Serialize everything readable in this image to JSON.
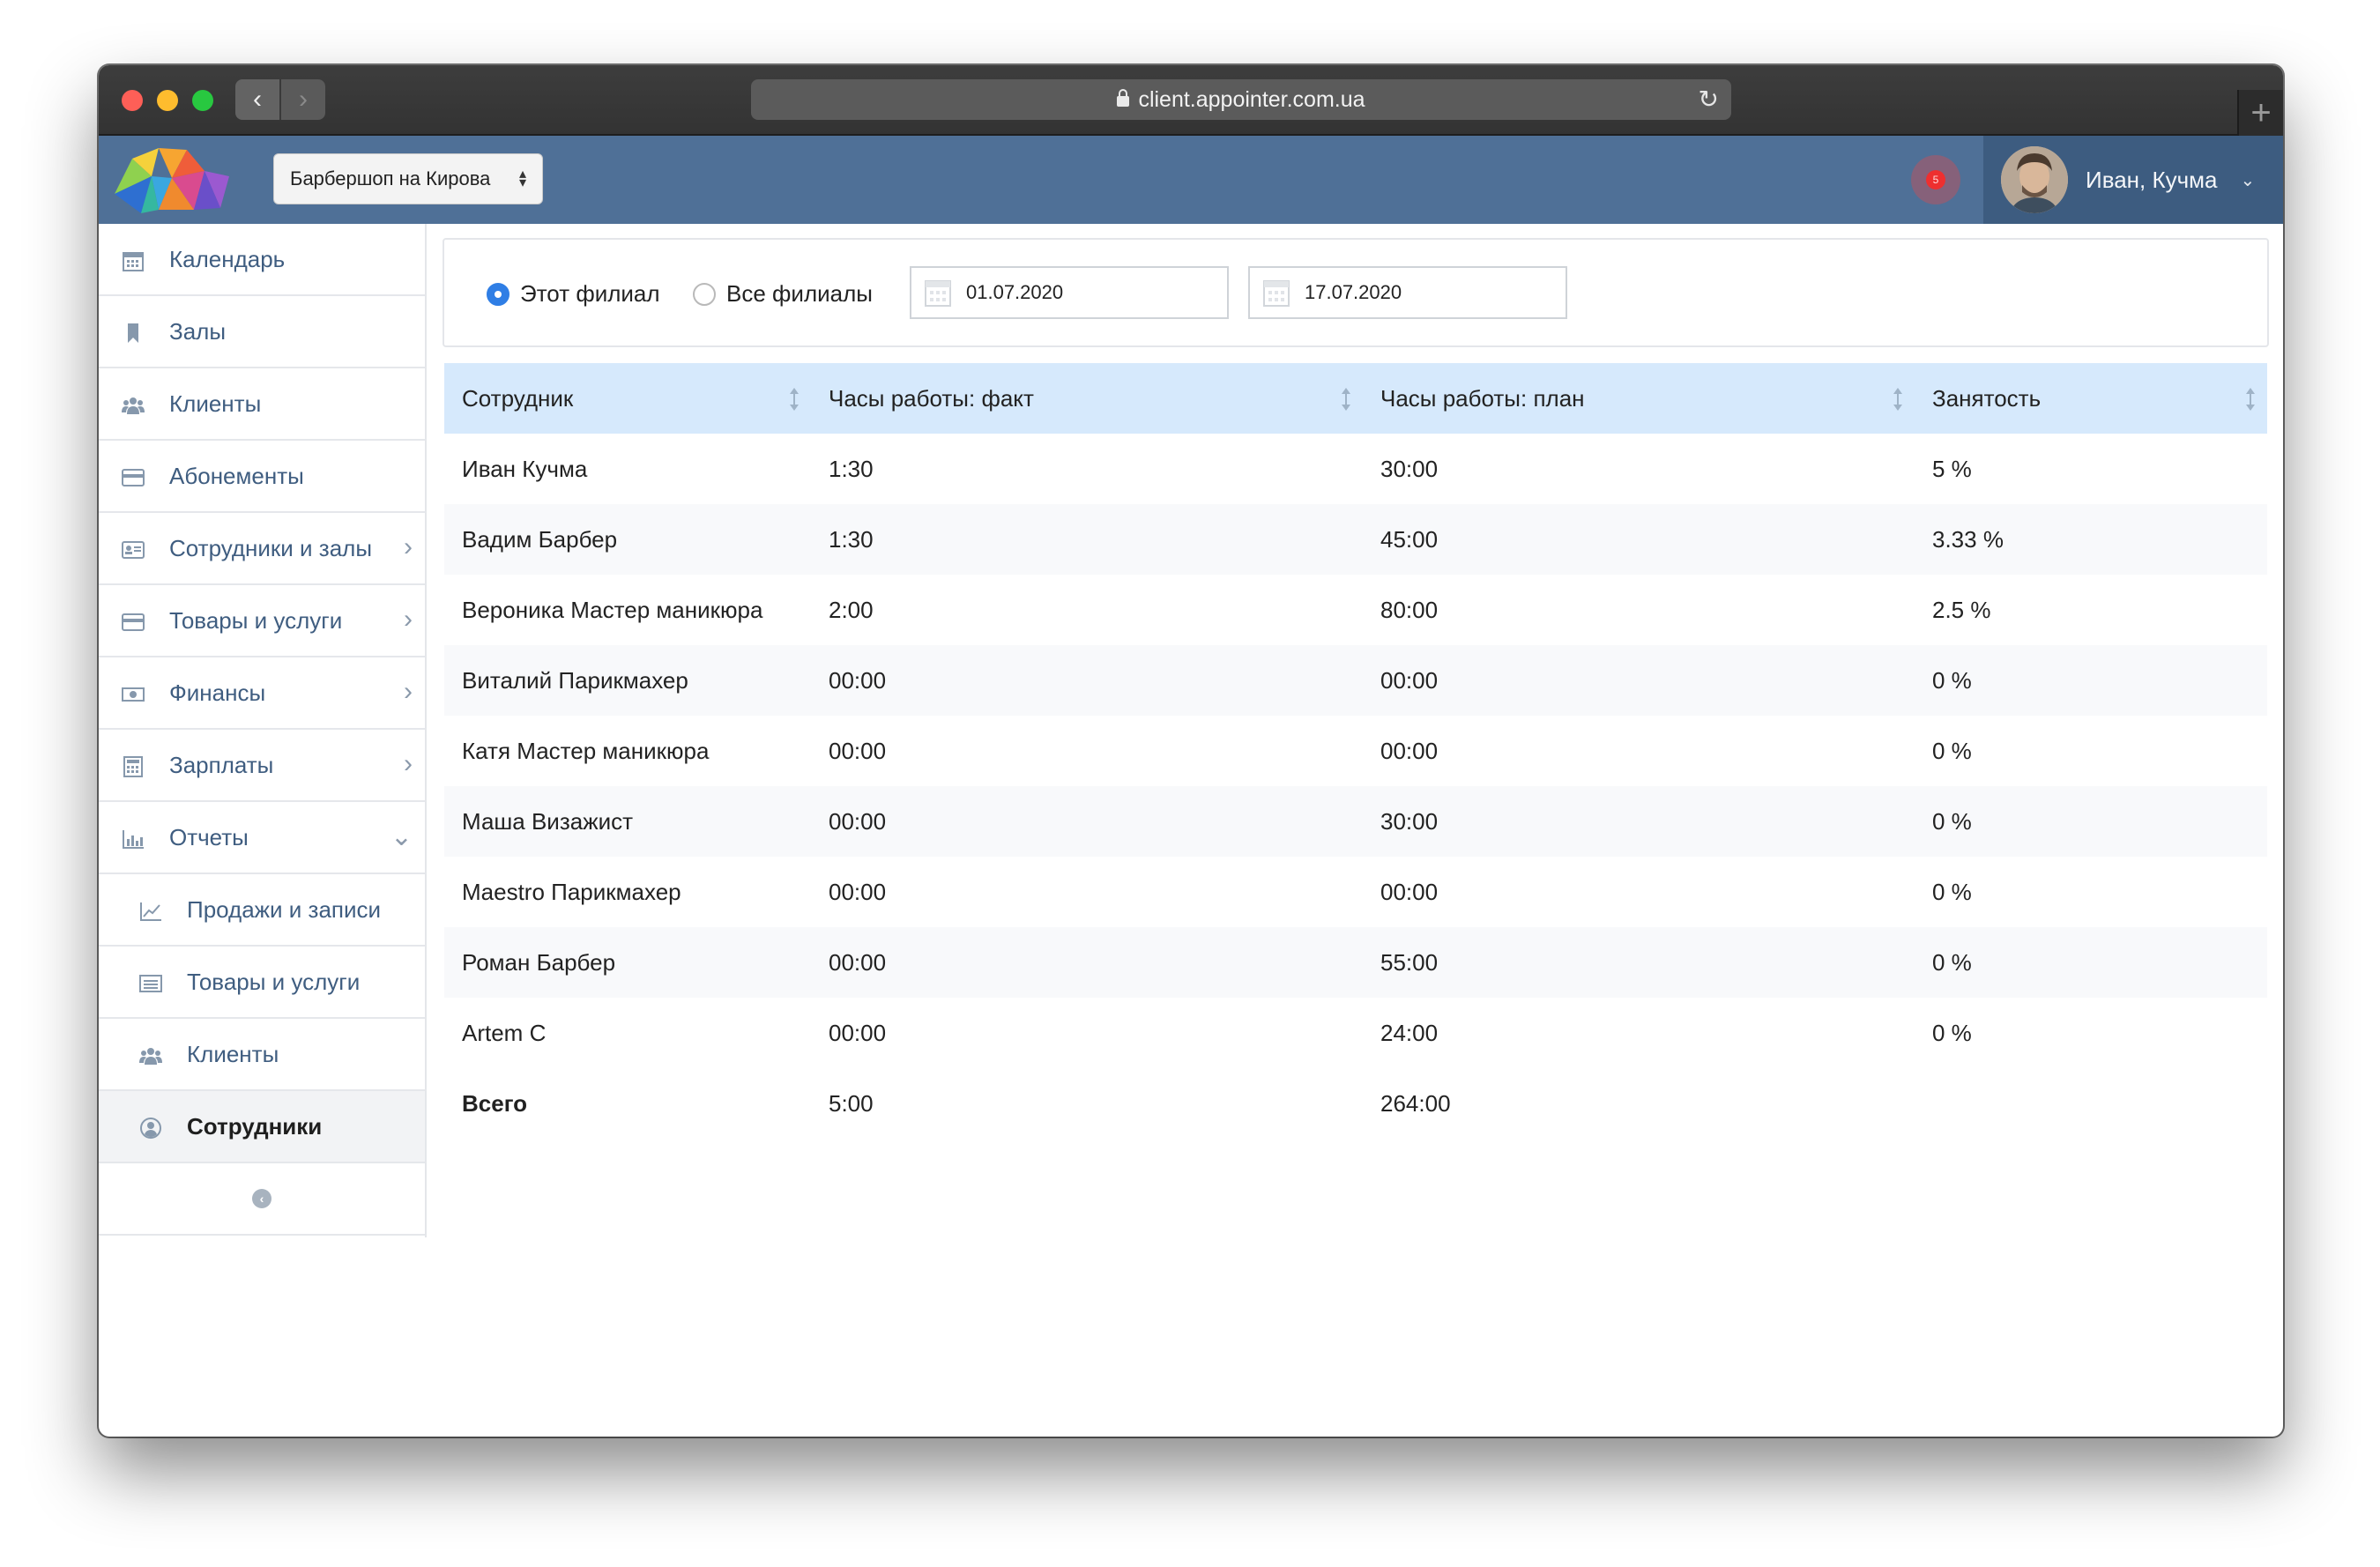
{
  "browser": {
    "url": "client.appointer.com.ua"
  },
  "header": {
    "branch": "Барбершоп на Кирова",
    "notifications_count": "5",
    "user_name": "Иван, Кучма"
  },
  "sidebar": {
    "items": [
      {
        "label": "Календарь",
        "icon": "calendar-icon"
      },
      {
        "label": "Залы",
        "icon": "bookmark-icon"
      },
      {
        "label": "Клиенты",
        "icon": "users-icon"
      },
      {
        "label": "Абонементы",
        "icon": "card-icon"
      },
      {
        "label": "Сотрудники и залы",
        "icon": "id-card-icon"
      },
      {
        "label": "Товары и услуги",
        "icon": "card-icon"
      },
      {
        "label": "Финансы",
        "icon": "money-icon"
      },
      {
        "label": "Зарплаты",
        "icon": "calculator-icon"
      },
      {
        "label": "Отчеты",
        "icon": "bar-chart-icon"
      }
    ],
    "report_items": [
      {
        "label": "Продажи и записи",
        "icon": "line-chart-icon"
      },
      {
        "label": "Товары и услуги",
        "icon": "list-icon"
      },
      {
        "label": "Клиенты",
        "icon": "users-icon"
      },
      {
        "label": "Сотрудники",
        "icon": "user-circle-icon"
      }
    ]
  },
  "filters": {
    "this_branch": "Этот филиал",
    "all_branches": "Все филиалы",
    "selected": "this_branch",
    "date_from": "01.07.2020",
    "date_to": "17.07.2020"
  },
  "table": {
    "columns": [
      "Сотрудник",
      "Часы работы: факт",
      "Часы работы: план",
      "Занятость"
    ],
    "rows": [
      [
        "Иван Кучма",
        "1:30",
        "30:00",
        "5 %"
      ],
      [
        "Вадим Барбер",
        "1:30",
        "45:00",
        "3.33 %"
      ],
      [
        "Вероника Мастер маникюра",
        "2:00",
        "80:00",
        "2.5 %"
      ],
      [
        "Виталий Парикмахер",
        "00:00",
        "00:00",
        "0 %"
      ],
      [
        "Катя Мастер маникюра",
        "00:00",
        "00:00",
        "0 %"
      ],
      [
        "Маша Визажист",
        "00:00",
        "30:00",
        "0 %"
      ],
      [
        "Maestro Парикмахер",
        "00:00",
        "00:00",
        "0 %"
      ],
      [
        "Роман Барбер",
        "00:00",
        "55:00",
        "0 %"
      ],
      [
        "Artem C",
        "00:00",
        "24:00",
        "0 %"
      ]
    ],
    "total": [
      "Всего",
      "5:00",
      "264:00",
      ""
    ]
  },
  "colors": {
    "header_bg": "#4f7097",
    "user_menu_bg": "#3d5c80",
    "table_header_bg": "#d6e9fc",
    "sidebar_text": "#3f5d80",
    "radio_accent": "#2f7ee5"
  }
}
